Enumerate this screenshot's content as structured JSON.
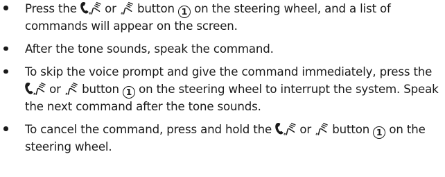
{
  "items": [
    {
      "segments": {
        "a": "Press the",
        "or": "or",
        "button_before": "button",
        "number": "1",
        "b": "on the steering wheel, and a list of commands will appear on the screen."
      },
      "icons": [
        "phone-voice-icon",
        "voice-icon"
      ]
    },
    {
      "text": "After the tone sounds, speak the command."
    },
    {
      "segments": {
        "a": "To skip the voice prompt and give the command immediately, press the",
        "or": "or",
        "button_before": "button",
        "number": "1",
        "b": "on the steering wheel to interrupt the system. Speak the next command after the tone sounds."
      },
      "icons": [
        "phone-voice-icon",
        "voice-icon"
      ]
    },
    {
      "segments": {
        "a": "To cancel the command, press and hold the",
        "or": "or",
        "button_before": "button",
        "number": "1",
        "b": "on the steering wheel."
      },
      "icons": [
        "phone-voice-icon",
        "voice-icon"
      ]
    }
  ],
  "colors": {
    "text": "#1a1a1a",
    "background": "#ffffff"
  }
}
